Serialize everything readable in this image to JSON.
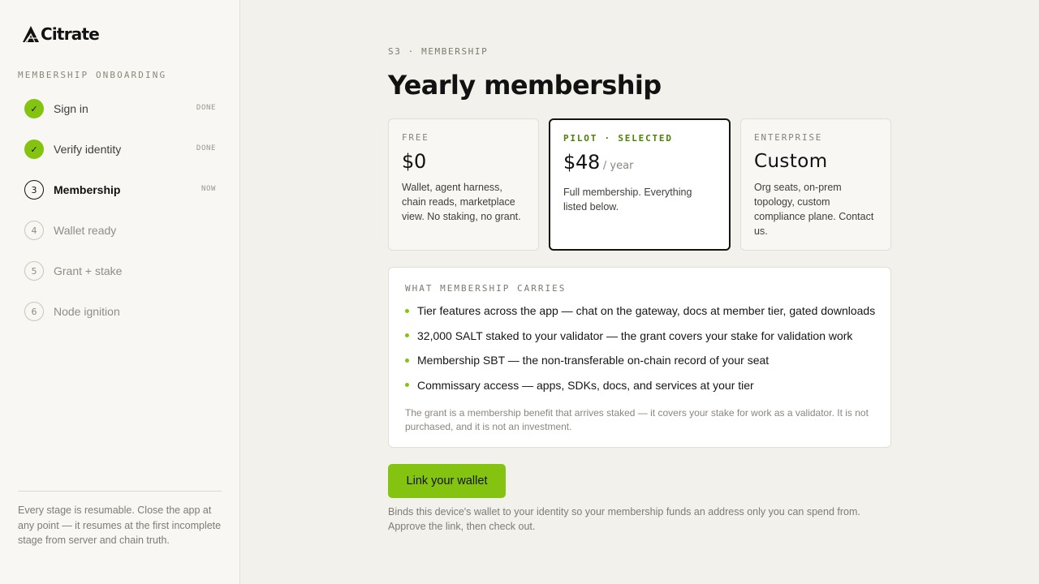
{
  "brand": {
    "name": "Citrate",
    "logo_icon": "citrate-logo-icon"
  },
  "sidebar": {
    "section_label": "MEMBERSHIP ONBOARDING",
    "steps": [
      {
        "marker": "✓",
        "label": "Sign in",
        "status": "DONE",
        "state": "done"
      },
      {
        "marker": "✓",
        "label": "Verify identity",
        "status": "DONE",
        "state": "done"
      },
      {
        "marker": "3",
        "label": "Membership",
        "status": "NOW",
        "state": "now"
      },
      {
        "marker": "4",
        "label": "Wallet ready",
        "status": "",
        "state": "todo"
      },
      {
        "marker": "5",
        "label": "Grant + stake",
        "status": "",
        "state": "todo"
      },
      {
        "marker": "6",
        "label": "Node ignition",
        "status": "",
        "state": "todo"
      }
    ],
    "footer": "Every stage is resumable. Close the app at any point — it resumes at the first incomplete stage from server and chain truth."
  },
  "main": {
    "eyebrow": "S3 · MEMBERSHIP",
    "title": "Yearly membership",
    "plans": [
      {
        "tier": "FREE",
        "price": "$0",
        "unit": "",
        "desc": "Wallet, agent harness, chain reads, marketplace view. No staking, no grant."
      },
      {
        "tier": "PILOT · SELECTED",
        "price": "$48",
        "unit": "/ year",
        "desc": "Full membership. Everything listed below."
      },
      {
        "tier": "ENTERPRISE",
        "price": "Custom",
        "unit": "",
        "desc": "Org seats, on-prem topology, custom compliance plane. Contact us."
      }
    ],
    "features": {
      "title": "WHAT MEMBERSHIP CARRIES",
      "items": [
        "Tier features across the app — chat on the gateway, docs at member tier, gated downloads",
        "32,000 SALT staked to your validator — the grant covers your stake for validation work",
        "Membership SBT — the non-transferable on-chain record of your seat",
        "Commissary access — apps, SDKs, docs, and services at your tier"
      ],
      "note": "The grant is a membership benefit that arrives staked — it covers your stake for work as a validator. It is not purchased, and it is not an investment."
    },
    "cta_label": "Link your wallet",
    "cta_help": "Binds this device's wallet to your identity so your membership funds an address only you can spend from. Approve the link, then check out."
  },
  "colors": {
    "accent": "#84c410",
    "selected_tier": "#4e7f05",
    "background": "#f3f1eb",
    "sidebar": "#f8f7f3"
  }
}
